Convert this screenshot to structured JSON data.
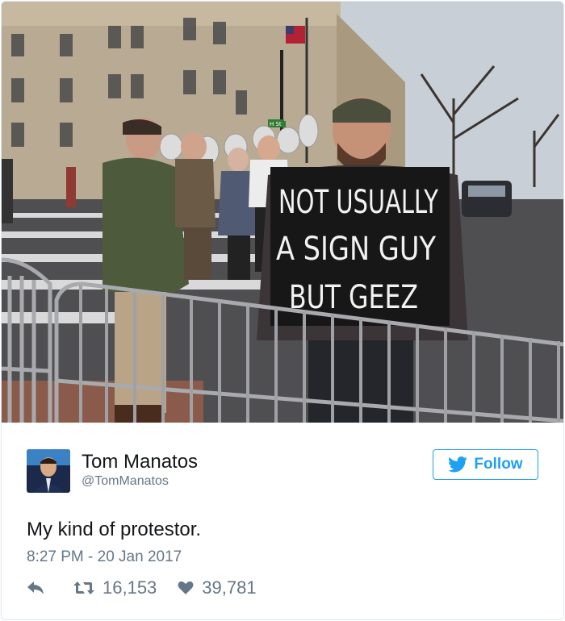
{
  "photo": {
    "sign_lines": [
      "NOT USUALLY",
      "A SIGN GUY",
      "BUT GEEZ"
    ],
    "street_sign": "H St"
  },
  "tweet": {
    "author_name": "Tom Manatos",
    "author_handle": "@TomManatos",
    "follow_label": "Follow",
    "text": "My kind of protestor.",
    "timestamp": "8:27 PM - 20 Jan 2017",
    "retweet_count": "16,153",
    "like_count": "39,781"
  },
  "colors": {
    "twitter_blue": "#1da1f2",
    "secondary_text": "#657786",
    "primary_text": "#14171a"
  },
  "icons": {
    "reply": "reply-icon",
    "retweet": "retweet-icon",
    "like": "heart-icon",
    "bird": "twitter-bird-icon"
  }
}
